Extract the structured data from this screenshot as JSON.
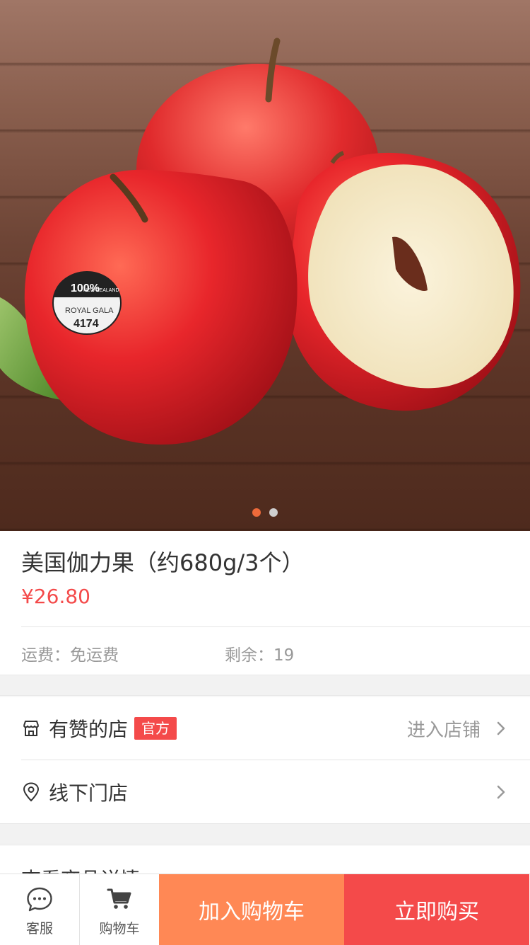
{
  "product": {
    "title": "美国伽力果（约680g/3个）",
    "price": "¥26.80",
    "shipping": "运费：免运费",
    "stock": "剩余：19",
    "image_label": {
      "line1": "100%",
      "line2": "ROYAL GALA",
      "line3": "4174",
      "line4": "NEW ZEALAND"
    }
  },
  "carousel": {
    "total": 2,
    "active": 0
  },
  "store": {
    "name": "有赞的店",
    "badge": "官方",
    "enter": "进入店铺",
    "offline": "线下门店"
  },
  "details": {
    "label": "查看商品详情"
  },
  "bottom_bar": {
    "service": "客服",
    "cart": "购物车",
    "add_to_cart": "加入购物车",
    "buy_now": "立即购买"
  },
  "colors": {
    "accent_red": "#f44a4a",
    "accent_orange": "#ff8855",
    "dot_active": "#ee6a3a"
  },
  "icons": [
    "store-icon",
    "location-pin-icon",
    "chevron-right-icon",
    "chat-bubble-icon",
    "shopping-cart-icon"
  ]
}
